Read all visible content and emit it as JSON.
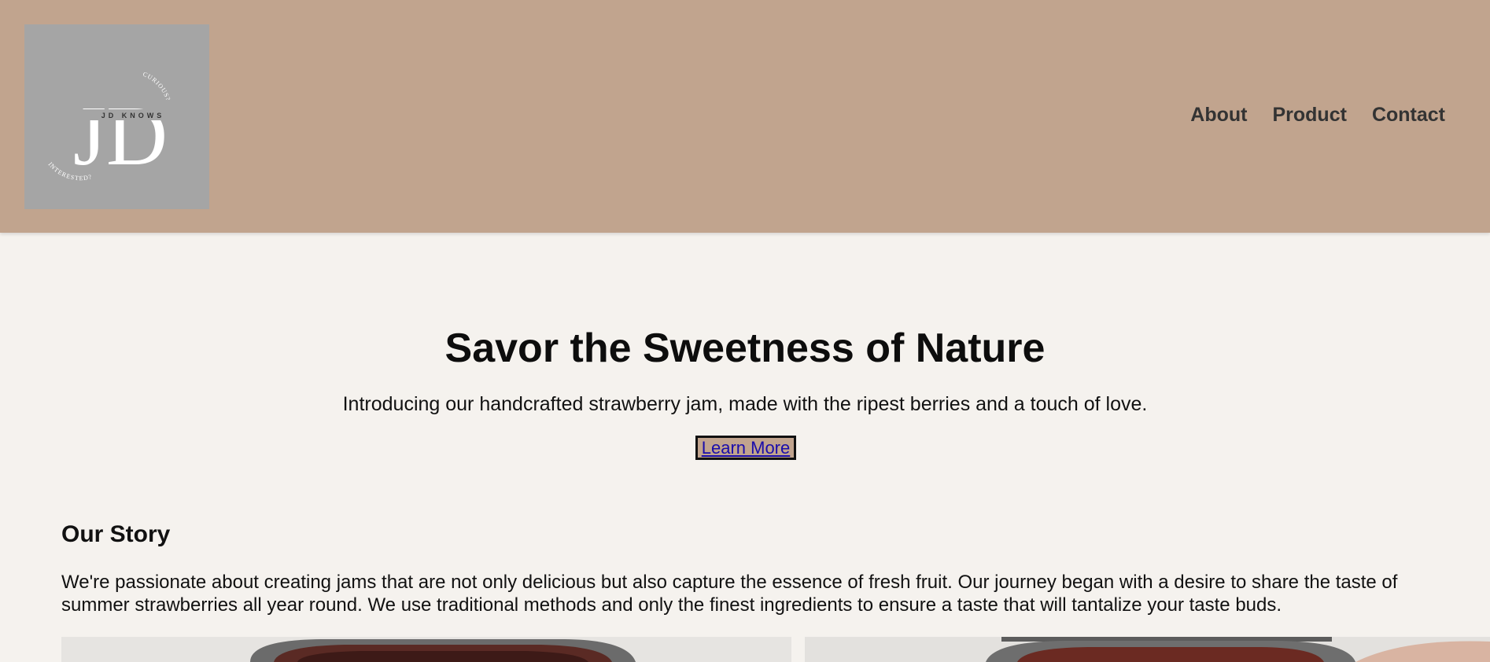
{
  "header": {
    "logo": {
      "monogram": "JD",
      "wordmark": "JD KNOWS",
      "arc_top": "CURIOUS?",
      "arc_bottom": "INTERESTED?"
    },
    "nav": [
      {
        "label": "About"
      },
      {
        "label": "Product"
      },
      {
        "label": "Contact"
      }
    ]
  },
  "hero": {
    "title": "Savor the Sweetness of Nature",
    "subtitle": "Introducing our handcrafted strawberry jam, made with the ripest berries and a touch of love.",
    "cta_label": "Learn More"
  },
  "story": {
    "title": "Our Story",
    "text": "We're passionate about creating jams that are not only delicious but also capture the essence of fresh fruit. Our journey began with a desire to share the taste of summer strawberries all year round. We use traditional methods and only the finest ingredients to ensure a taste that will tantalize your taste buds."
  },
  "colors": {
    "header_bg": "#c1a48e",
    "page_bg": "#f5f2ee",
    "logo_bg": "#a5a5a5"
  }
}
